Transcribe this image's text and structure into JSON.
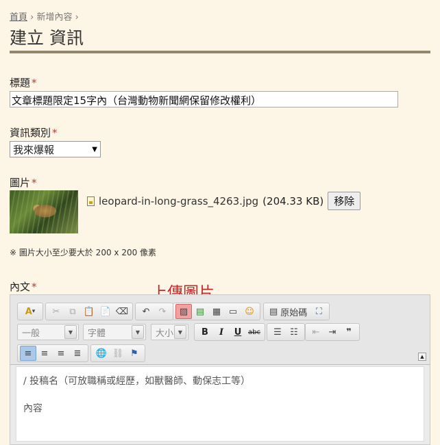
{
  "breadcrumb": {
    "home": "首頁",
    "sep": "›",
    "current": "新增內容",
    "trail": "›"
  },
  "page_title": "建立 資訊",
  "fields": {
    "title": {
      "label": "標題",
      "required_mark": "*",
      "value": "文章標題限定15字內（台灣動物新聞網保留修改權利）"
    },
    "category": {
      "label": "資訊類別",
      "required_mark": "*",
      "selected": "我來爆報",
      "arrow": "▼"
    },
    "image": {
      "label": "圖片",
      "required_mark": "*",
      "file_name": "leopard-in-long-grass_4263.jpg",
      "file_size": "(204.33 KB)",
      "remove_label": "移除",
      "note": "※ 圖片大小至少要大於 200 x 200 像素"
    },
    "body": {
      "label": "內文",
      "required_mark": "*"
    }
  },
  "annotation": "上傳圖片",
  "editor": {
    "toolbar": {
      "font_color": "A",
      "dropdown_caret": "▾",
      "undo": "↶",
      "redo": "↷",
      "source_label": "原始碼",
      "format_combo": "一般",
      "font_combo": "字體",
      "size_combo": "大小",
      "combo_arrow": "▼",
      "bold": "B",
      "italic": "I",
      "underline": "U",
      "strike": "abc",
      "blockquote": "❞",
      "collapse": "▲"
    },
    "content_lines": [
      "/ 投稿名（可放職稱或經歷，如獸醫師、動保志工等）",
      "內容"
    ]
  },
  "colors": {
    "background": "#fdf5e6",
    "rule": "#94866a",
    "required": "#cc3333",
    "annotation": "#c62828"
  }
}
